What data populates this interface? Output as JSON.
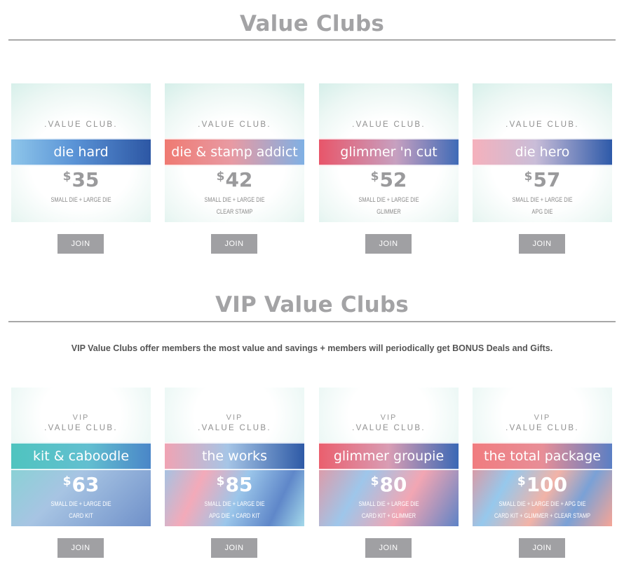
{
  "sections": {
    "value": {
      "title": "Value Clubs"
    },
    "vip": {
      "title": "VIP Value Clubs",
      "intro": "VIP Value Clubs offer members the most value and savings + members will periodically get BONUS Deals and Gifts."
    }
  },
  "card_label": {
    "club": ".VALUE CLUB.",
    "vip": "VIP",
    "currency": "$"
  },
  "join_label": "JOIN",
  "value_clubs": [
    {
      "name": "die hard",
      "price": "35",
      "lines": [
        "SMALL DIE + LARGE DIE"
      ],
      "band_color": "#4f86cf"
    },
    {
      "name": "die & stamp addict",
      "price": "42",
      "lines": [
        "SMALL DIE + LARGE DIE",
        "CLEAR STAMP"
      ],
      "band_color": "#e8786f"
    },
    {
      "name": "glimmer 'n cut",
      "price": "52",
      "lines": [
        "SMALL DIE + LARGE DIE",
        "GLIMMER"
      ],
      "band_color": "#e9636f"
    },
    {
      "name": "die hero",
      "price": "57",
      "lines": [
        "SMALL DIE + LARGE DIE",
        "APG DIE"
      ],
      "band_color": "#f3a6b3"
    }
  ],
  "vip_clubs": [
    {
      "name": "kit & caboodle",
      "price": "63",
      "lines": [
        "SMALL DIE + LARGE DIE",
        "CARD KIT"
      ],
      "band_color": "#5cc9c2"
    },
    {
      "name": "the works",
      "price": "85",
      "lines": [
        "SMALL DIE + LARGE DIE",
        "APG DIE + CARD KIT"
      ],
      "band_color": "#f1a7b5"
    },
    {
      "name": "glimmer groupie",
      "price": "80",
      "lines": [
        "SMALL DIE + LARGE DIE",
        "CARD KIT + GLIMMER"
      ],
      "band_color": "#ea6b78"
    },
    {
      "name": "the total package",
      "price": "100",
      "lines": [
        "SMALL DIE + LARGE DIE + APG DIE",
        "CARD KIT + GLIMMER + CLEAR STAMP"
      ],
      "band_color": "#ee7d80"
    }
  ]
}
